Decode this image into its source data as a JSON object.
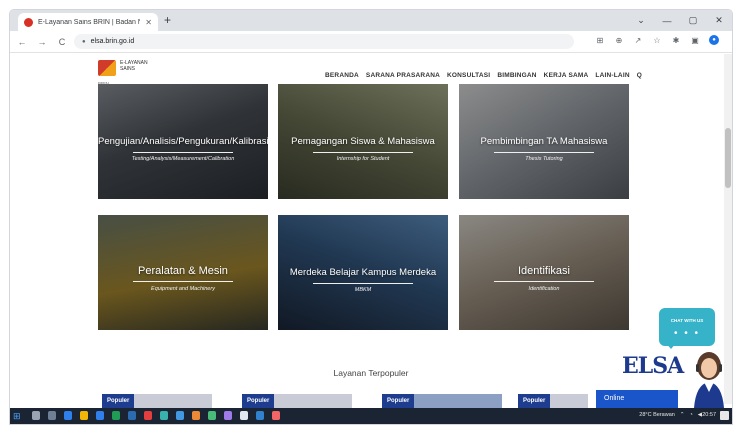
{
  "browser": {
    "tab_title": "E-Layanan Sains BRIN | Badan N...",
    "tab_close": "✕",
    "new_tab": "+",
    "url": "elsa.brin.go.id",
    "window_controls": [
      "⌄",
      "—",
      "▢",
      "✕"
    ]
  },
  "site": {
    "logo_line1": "E-LAYANAN",
    "logo_line2": "SAINS",
    "logo_sub": "BRIN",
    "menu": [
      "BERANDA",
      "SARANA PRASARANA",
      "KONSULTASI",
      "BIMBINGAN",
      "KERJA SAMA",
      "LAIN-LAIN"
    ],
    "search_icon": "Q"
  },
  "cards": [
    {
      "title": "Pengujian/Analisis/Pengukuran/Kalibrasi",
      "sub": "Testing/Analysis/Measurement/Calibration"
    },
    {
      "title": "Pemagangan Siswa & Mahasiswa",
      "sub": "Internship for Student"
    },
    {
      "title": "Pembimbingan TA Mahasiswa",
      "sub": "Thesis Tutoring"
    },
    {
      "title": "Peralatan & Mesin",
      "sub": "Equipment and Machinery"
    },
    {
      "title": "Merdeka Belajar Kampus Merdeka",
      "sub": "MBKM"
    },
    {
      "title": "Identifikasi",
      "sub": "Identification"
    }
  ],
  "section_title": "Layanan Terpopuler",
  "popular_label": "Populer",
  "online_label": "Online",
  "chat": {
    "label": "CHAT WITH US",
    "dots": "• • •",
    "brand": "ELSA"
  },
  "taskbar": {
    "weather": "28°C  Berawan",
    "clock": "20:57"
  },
  "colors": {
    "accent_blue": "#1e3d8f",
    "chat_teal": "#36b3c9",
    "taskbar": "#1b2433"
  }
}
